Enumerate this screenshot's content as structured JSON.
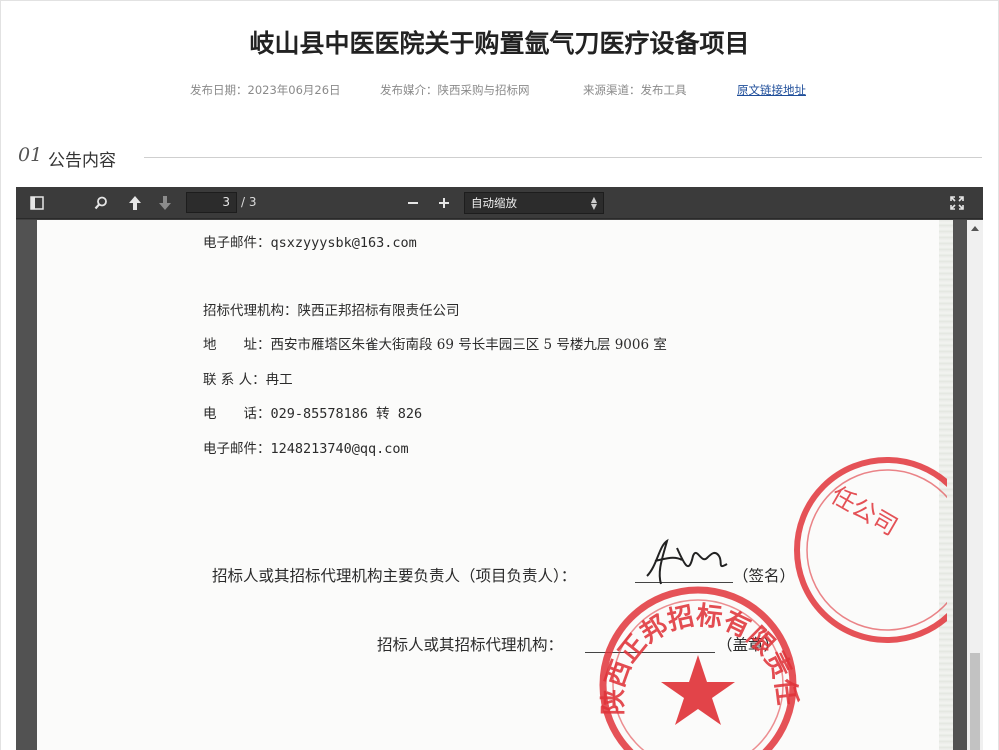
{
  "header": {
    "title": "岐山县中医医院关于购置氩气刀医疗设备项目",
    "publish_date": "发布日期：2023年06月26日",
    "publish_media": "发布媒介：陕西采购与招标网",
    "source_channel": "来源渠道：发布工具",
    "original_link": "原文链接地址"
  },
  "section": {
    "number": "01",
    "label": "公告内容"
  },
  "pdf_viewer": {
    "current_page": "3",
    "page_count": "/ 3",
    "zoom": "自动缩放",
    "icons": [
      "sidebar-toggle-icon",
      "search-icon",
      "previous-page-icon",
      "next-page-icon",
      "zoom-out-icon",
      "zoom-in-icon",
      "fullscreen-icon"
    ]
  },
  "document": {
    "email1_label": "电子邮件：",
    "email1_value": "qsxzyyysbk@163.com",
    "agency_line": "招标代理机构：陕西正邦招标有限责任公司",
    "address_label": "地　　址：",
    "address_value": "西安市雁塔区朱雀大街南段 69 号长丰园三区 5 号楼九层 9006 室",
    "contact_label": "联 系 人：",
    "contact_value": "冉工",
    "phone_label": "电　　话：",
    "phone_value": "029-85578186 转 826",
    "email2_label": "电子邮件：",
    "email2_value": "1248213740@qq.com",
    "signature_line": "招标人或其招标代理机构主要负责人（项目负责人）：",
    "signature_suffix": "（签名）",
    "seal_line": "招标人或其招标代理机构：",
    "seal_suffix": "（盖章）",
    "stamp_text": "陕西正邦招标有限责任公司",
    "stamp_color": "#e0343a"
  }
}
